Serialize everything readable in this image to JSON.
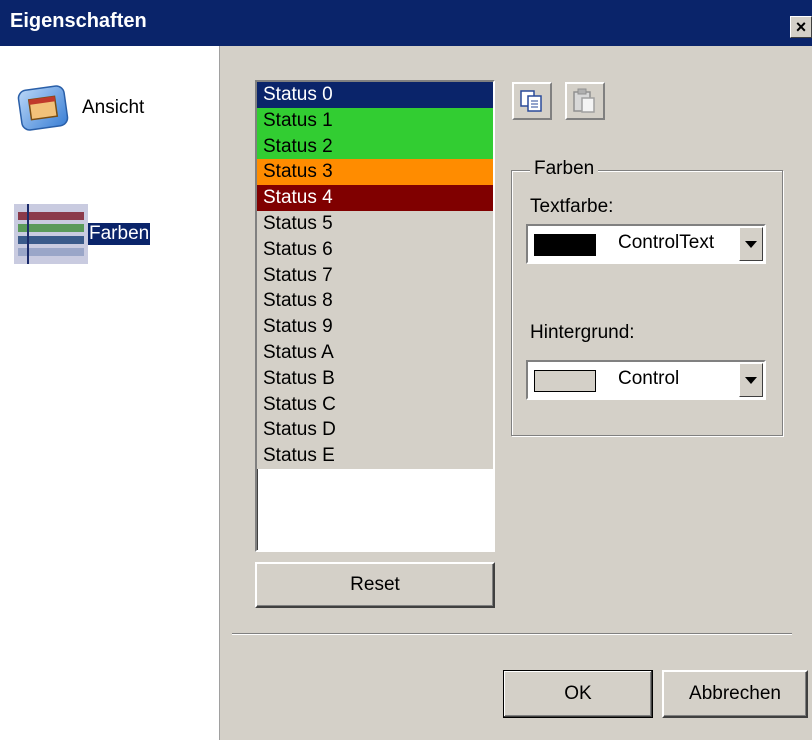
{
  "window": {
    "title": "Eigenschaften",
    "close_symbol": "×"
  },
  "nav": {
    "items": [
      {
        "label": "Ansicht",
        "icon": "window-icon",
        "selected": false
      },
      {
        "label": "Farben",
        "icon": "color-bars-icon",
        "selected": true
      }
    ]
  },
  "status_list": {
    "items": [
      {
        "label": "Status 0",
        "bg": "#0a246a",
        "fg": "#ffffff"
      },
      {
        "label": "Status 1",
        "bg": "#32cd32",
        "fg": "#000000"
      },
      {
        "label": "Status 2",
        "bg": "#32cd32",
        "fg": "#000000"
      },
      {
        "label": "Status 3",
        "bg": "#ff8c00",
        "fg": "#000000"
      },
      {
        "label": "Status 4",
        "bg": "#800000",
        "fg": "#ffffff"
      },
      {
        "label": "Status 5",
        "bg": "#d4d0c8",
        "fg": "#000000"
      },
      {
        "label": "Status 6",
        "bg": "#d4d0c8",
        "fg": "#000000"
      },
      {
        "label": "Status 7",
        "bg": "#d4d0c8",
        "fg": "#000000"
      },
      {
        "label": "Status 8",
        "bg": "#d4d0c8",
        "fg": "#000000"
      },
      {
        "label": "Status 9",
        "bg": "#d4d0c8",
        "fg": "#000000"
      },
      {
        "label": "Status A",
        "bg": "#d4d0c8",
        "fg": "#000000"
      },
      {
        "label": "Status B",
        "bg": "#d4d0c8",
        "fg": "#000000"
      },
      {
        "label": "Status C",
        "bg": "#d4d0c8",
        "fg": "#000000"
      },
      {
        "label": "Status D",
        "bg": "#d4d0c8",
        "fg": "#000000"
      },
      {
        "label": "Status E",
        "bg": "#d4d0c8",
        "fg": "#000000"
      }
    ]
  },
  "toolbar": {
    "copy_icon": "copy-icon",
    "paste_icon": "paste-icon"
  },
  "reset_label": "Reset",
  "colors_group": {
    "legend": "Farben",
    "text_color_label": "Textfarbe:",
    "text_color_value": "ControlText",
    "text_color_swatch": "#000000",
    "background_label": "Hintergrund:",
    "background_value": "Control",
    "background_swatch": "#d4d0c8"
  },
  "buttons": {
    "ok": "OK",
    "cancel": "Abbrechen"
  }
}
